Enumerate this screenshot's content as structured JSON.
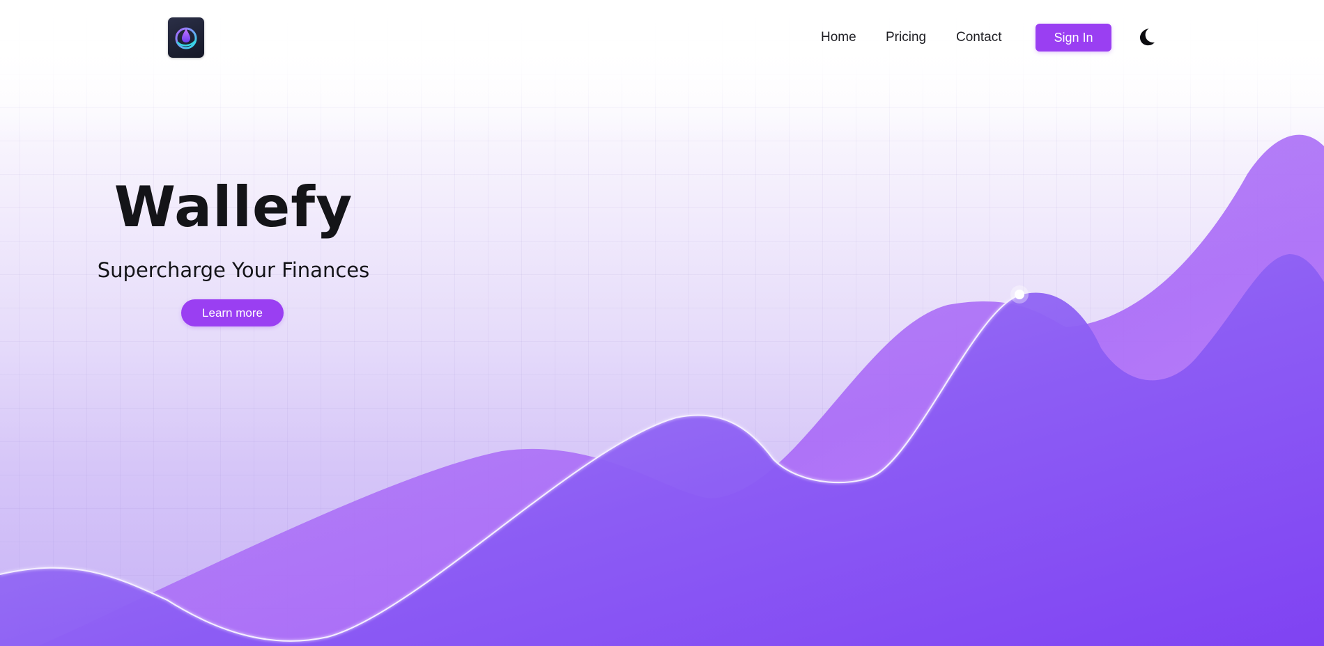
{
  "app": {
    "logo_icon": "wallet-drop-logo-icon"
  },
  "nav": {
    "links": [
      {
        "label": "Home"
      },
      {
        "label": "Pricing"
      },
      {
        "label": "Contact"
      }
    ],
    "signin_label": "Sign In",
    "theme_toggle_icon": "moon-icon"
  },
  "hero": {
    "title": "Wallefy",
    "subtitle": "Supercharge Your Finances",
    "cta_label": "Learn more"
  },
  "colors": {
    "accent": "#9a3ff2",
    "wave_back": "#b07af9",
    "wave_front": "#8a55f4",
    "text": "#141418"
  }
}
